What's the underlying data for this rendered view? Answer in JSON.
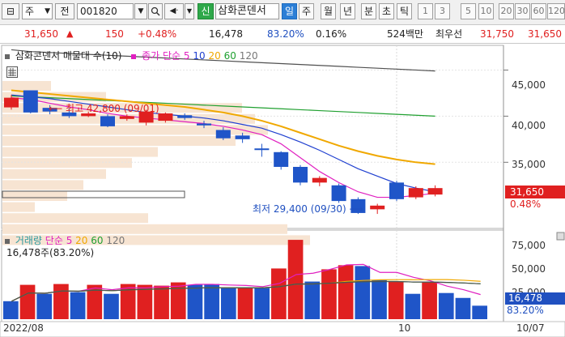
{
  "toolbar": {
    "stock_type": "주",
    "prev_label": "전",
    "code": "001820",
    "tag_new": "신",
    "stock_name": "삼화콘덴서",
    "periods": [
      "일",
      "주",
      "월",
      "년",
      "분",
      "초",
      "틱"
    ],
    "active_period": "일",
    "intervals": [
      "1",
      "3",
      "5",
      "10",
      "20",
      "30",
      "60",
      "120"
    ]
  },
  "quote": {
    "price": "31,650",
    "change": "150",
    "change_pct": "+0.48%",
    "volume": "16,478",
    "vol_ratio": "83.20%",
    "turnover": "0.16%",
    "amount": "524백만",
    "best_ask_label": "최우선",
    "ask1": "31,750",
    "ask2": "31,650"
  },
  "price_panel": {
    "title": "삼화콘덴서 매물대 수(10)",
    "ma_title": "종가 단순",
    "ma_periods": [
      "5",
      "10",
      "20",
      "60",
      "120"
    ],
    "ma_colors": [
      "#e020c0",
      "#2040d0",
      "#f0a800",
      "#20a030",
      "#505050"
    ],
    "high_label": "최고 42,800 (09/01)",
    "low_label": "최저 29,400 (09/30)",
    "axis": [
      "45,000",
      "40,000",
      "35,000"
    ],
    "current_price": "31,650",
    "current_pct": "0.48%"
  },
  "volume_panel": {
    "title": "거래량",
    "ma_title": "단순",
    "ma_periods": [
      "5",
      "20",
      "60",
      "120"
    ],
    "info": "16,478주(83.20%)",
    "axis": [
      "75,000",
      "50,000",
      "25,000"
    ],
    "current": "16,478",
    "current_pct": "83.20%"
  },
  "date_axis": {
    "start": "2022/08",
    "mid": "10",
    "end": "10/07"
  },
  "chart_data": {
    "type": "candlestick",
    "dates_label": [
      "2022/08",
      "10",
      "10/07"
    ],
    "ylim": [
      28000,
      47500
    ],
    "candles": [
      {
        "o": 40950,
        "c": 42000,
        "h": 42300,
        "l": 40700,
        "up": true
      },
      {
        "o": 40400,
        "c": 42800,
        "h": 42800,
        "l": 40300,
        "up": false
      },
      {
        "o": 40900,
        "c": 40500,
        "h": 41200,
        "l": 40200,
        "up": false
      },
      {
        "o": 40000,
        "c": 40400,
        "h": 40900,
        "l": 39800,
        "up": false
      },
      {
        "o": 40000,
        "c": 40300,
        "h": 40500,
        "l": 39900,
        "up": true
      },
      {
        "o": 40000,
        "c": 38900,
        "h": 40200,
        "l": 38800,
        "up": false
      },
      {
        "o": 39700,
        "c": 40000,
        "h": 40200,
        "l": 39500,
        "up": true
      },
      {
        "o": 39300,
        "c": 40500,
        "h": 40700,
        "l": 39000,
        "up": true
      },
      {
        "o": 39500,
        "c": 40300,
        "h": 40400,
        "l": 39300,
        "up": true
      },
      {
        "o": 40100,
        "c": 39800,
        "h": 40300,
        "l": 39600,
        "up": false
      },
      {
        "o": 39000,
        "c": 39200,
        "h": 39500,
        "l": 38700,
        "up": false
      },
      {
        "o": 37600,
        "c": 38500,
        "h": 38800,
        "l": 37400,
        "up": false
      },
      {
        "o": 37500,
        "c": 37900,
        "h": 38200,
        "l": 37100,
        "up": false
      },
      {
        "o": 36500,
        "c": 36400,
        "h": 37000,
        "l": 35600,
        "up": false
      },
      {
        "o": 34500,
        "c": 36100,
        "h": 36200,
        "l": 34200,
        "up": false
      },
      {
        "o": 32800,
        "c": 34500,
        "h": 34700,
        "l": 32500,
        "up": false
      },
      {
        "o": 32800,
        "c": 33300,
        "h": 33500,
        "l": 32400,
        "up": true
      },
      {
        "o": 30800,
        "c": 32500,
        "h": 32700,
        "l": 30600,
        "up": false
      },
      {
        "o": 29500,
        "c": 31000,
        "h": 31200,
        "l": 29400,
        "up": false
      },
      {
        "o": 29900,
        "c": 30300,
        "h": 30500,
        "l": 29400,
        "up": true
      },
      {
        "o": 31000,
        "c": 32800,
        "h": 33000,
        "l": 30800,
        "up": false
      },
      {
        "o": 31200,
        "c": 32200,
        "h": 32400,
        "l": 31000,
        "up": true
      },
      {
        "o": 31500,
        "c": 32200,
        "h": 32500,
        "l": 31300,
        "up": true
      }
    ],
    "ma_lines": {
      "ma5": [
        42000,
        41800,
        41400,
        41000,
        40700,
        40300,
        40000,
        39800,
        39600,
        39400,
        39200,
        38900,
        38500,
        38000,
        37000,
        35500,
        34000,
        32800,
        31800,
        31200,
        31200,
        31400,
        31650
      ],
      "ma10": [
        42300,
        42100,
        41900,
        41600,
        41300,
        41000,
        40700,
        40400,
        40200,
        40000,
        39800,
        39500,
        39100,
        38700,
        38000,
        37200,
        36300,
        35300,
        34300,
        33500,
        32700,
        32200,
        31800
      ],
      "ma20": [
        42800,
        42600,
        42400,
        42200,
        42000,
        41800,
        41600,
        41400,
        41200,
        41000,
        40700,
        40400,
        40000,
        39500,
        38900,
        38200,
        37500,
        36800,
        36200,
        35700,
        35300,
        35000,
        34800
      ],
      "ma60": [
        42200,
        42100,
        42000,
        41900,
        41800,
        41700,
        41600,
        41500,
        41400,
        41300,
        41200,
        41100,
        41000,
        40900,
        40800,
        40700,
        40600,
        40500,
        40400,
        40300,
        40200,
        40100,
        40000
      ],
      "ma120": [
        47200,
        47000,
        46900,
        46800,
        46700,
        46600,
        46500,
        46400,
        46300,
        46200,
        46100,
        46000,
        45900,
        45800,
        45700,
        45600,
        45500,
        45400,
        45300,
        45200,
        45100,
        45000,
        44900
      ]
    },
    "volume": [
      22000,
      42000,
      31000,
      43000,
      33000,
      42000,
      31000,
      43000,
      42000,
      41000,
      45000,
      42000,
      43000,
      38000,
      38000,
      38000,
      62000,
      97000,
      46000,
      61000,
      66000,
      65000,
      48000,
      46000,
      31000,
      45000,
      32000,
      26000,
      16478
    ],
    "volume_up": [
      false,
      true,
      false,
      true,
      false,
      true,
      false,
      true,
      true,
      true,
      true,
      false,
      false,
      false,
      true,
      false,
      true,
      true,
      false,
      true,
      true,
      false,
      false,
      true,
      false,
      true,
      false,
      false,
      false
    ],
    "vol_ylim": [
      0,
      105000
    ],
    "volume_profile": [
      0.15,
      0.32,
      0.74,
      0.78,
      0.82,
      0.72,
      0.48,
      0.4,
      0.32,
      0.25,
      0.2,
      0.1,
      0.45,
      0.88,
      0.95
    ]
  }
}
